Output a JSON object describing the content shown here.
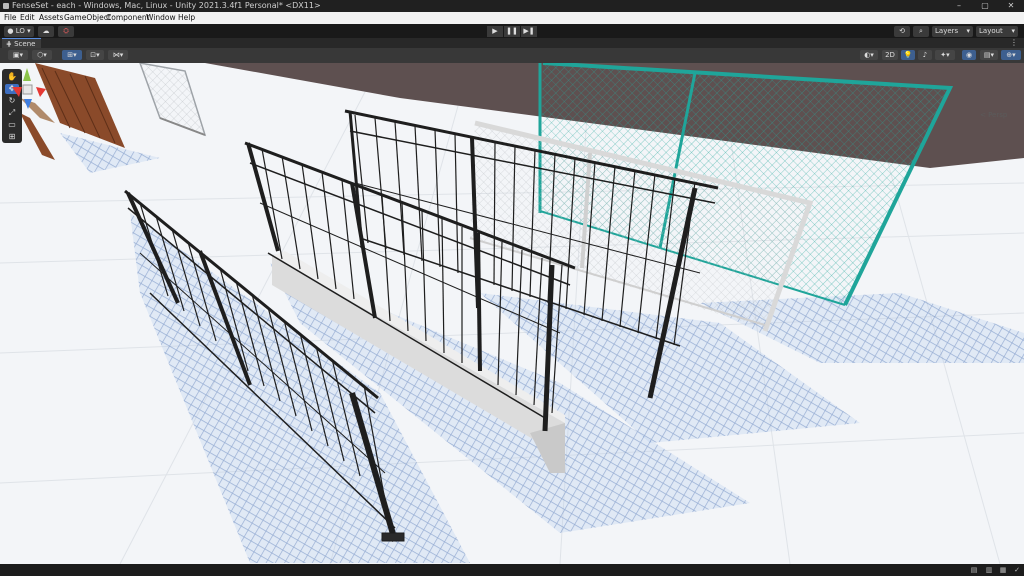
{
  "window": {
    "title": "FenseSet - each - Windows, Mac, Linux - Unity 2021.3.4f1 Personal* <DX11>",
    "minimize": "–",
    "maximize": "▢",
    "close": "✕"
  },
  "menu": [
    "File",
    "Edit",
    "Assets",
    "GameObject",
    "Component",
    "Window",
    "Help"
  ],
  "toolbar": {
    "account": "LO",
    "cloud_icon": "cloud-icon",
    "collab_icon": "collab-icon",
    "play_icon": "▶",
    "pause_icon": "❚❚",
    "step_icon": "▶❚",
    "history_icon": "history-icon",
    "search_icon": "search-icon",
    "layers": "Layers",
    "layout": "Layout"
  },
  "scene_tab": {
    "label": "Scene"
  },
  "scene_toolbar": {
    "toggle_2d": "2D",
    "persp_label": "< Persp"
  },
  "tools": [
    "hand",
    "move",
    "rotate",
    "scale",
    "rect",
    "transform"
  ],
  "colors": {
    "accent_blue": "#3d6ec0",
    "fence_teal": "#1fa59a",
    "fence_dark": "#1e1e1e",
    "fence_white": "#d9d9d9",
    "fence_wood": "#8a4a2a",
    "sky_brown": "#5e5050",
    "ground": "#f3f5f8"
  }
}
